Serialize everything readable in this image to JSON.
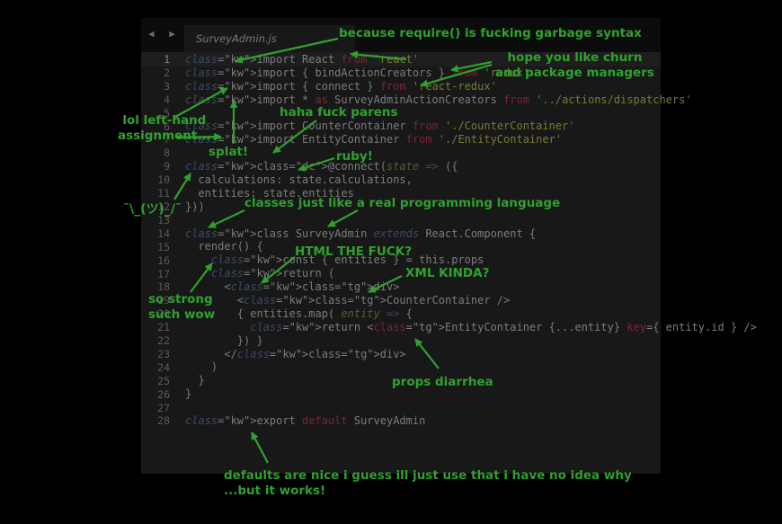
{
  "editor": {
    "tab_title": "SurveyAdmin.js",
    "nav_arrows": "◀ ▶",
    "line_numbers": [
      "1",
      "2",
      "3",
      "4",
      "5",
      "6",
      "7",
      "8",
      "9",
      "10",
      "11",
      "12",
      "13",
      "14",
      "15",
      "16",
      "17",
      "18",
      "19",
      "20",
      "21",
      "22",
      "23",
      "24",
      "25",
      "26",
      "27",
      "28"
    ],
    "lines": [
      "import React from 'react'",
      "import { bindActionCreators } from 'redux'",
      "import { connect } from 'react-redux'",
      "import * as SurveyAdminActionCreators from '../actions/dispatchers'",
      "",
      "import CounterContainer from './CounterContainer'",
      "import EntityContainer from './EntityContainer'",
      "",
      "@connect(state => ({",
      "  calculations: state.calculations,",
      "  entities: state.entities",
      "}))",
      "",
      "class SurveyAdmin extends React.Component {",
      "  render() {",
      "    const { entities } = this.props",
      "    return (",
      "      <div>",
      "        <CounterContainer />",
      "        { entities.map( entity => {",
      "          return <EntityContainer {...entity} key={ entity.id } />",
      "        }) }",
      "      </div>",
      "    )",
      "  }",
      "}",
      "",
      "export default SurveyAdmin"
    ]
  },
  "annotations": {
    "require": "because require() is fucking garbage syntax",
    "churn": "hope you like churn\nand package managers",
    "lol": "lol left-hand\nassignment...",
    "parens": "haha fuck parens",
    "splat": "splat!",
    "ruby": "ruby!",
    "shrug": "¯\\_(ツ)_/¯",
    "classes": "classes just like a real programming language",
    "html": "HTML THE FUCK?",
    "xml": "XML KINDA?",
    "strong": "so strong\nsuch wow",
    "props": "props diarrhea",
    "defaults": "defaults are nice i guess ill just use that i have no idea why\n...but it works!"
  },
  "colors": {
    "annotation": "#2fa12f",
    "keyword": "#7a2533",
    "string": "#7a7a34"
  }
}
